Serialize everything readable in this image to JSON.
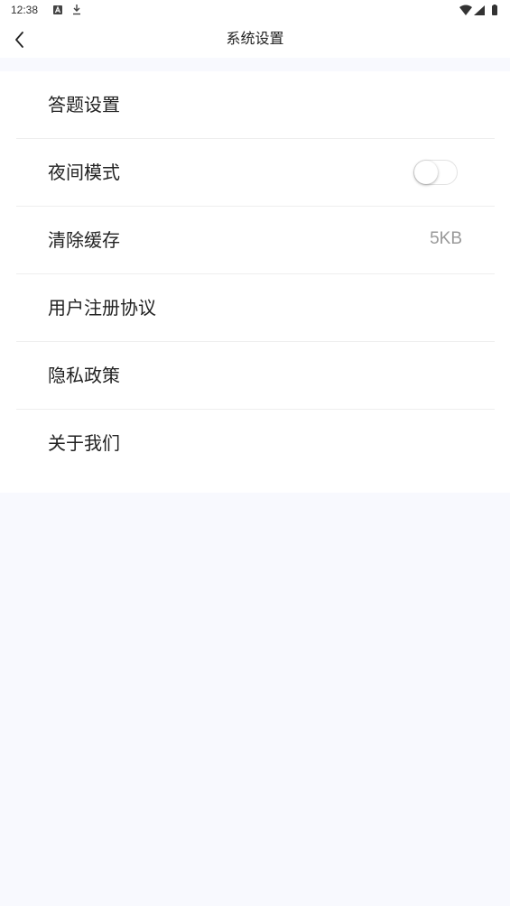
{
  "status_bar": {
    "time": "12:38",
    "icons": [
      "a-box-icon",
      "download-icon",
      "wifi-icon",
      "signal-icon",
      "battery-icon"
    ]
  },
  "nav": {
    "title": "系统设置",
    "back_icon": "chevron-left-icon"
  },
  "settings": {
    "answer_settings": {
      "label": "答题设置"
    },
    "night_mode": {
      "label": "夜间模式",
      "enabled": false
    },
    "clear_cache": {
      "label": "清除缓存",
      "value": "5KB"
    },
    "user_agreement": {
      "label": "用户注册协议"
    },
    "privacy_policy": {
      "label": "隐私政策"
    },
    "about_us": {
      "label": "关于我们"
    }
  },
  "colors": {
    "page_background": "#f8f9fe",
    "card_background": "#ffffff",
    "divider": "#eeeeee",
    "secondary_text": "#999999"
  }
}
